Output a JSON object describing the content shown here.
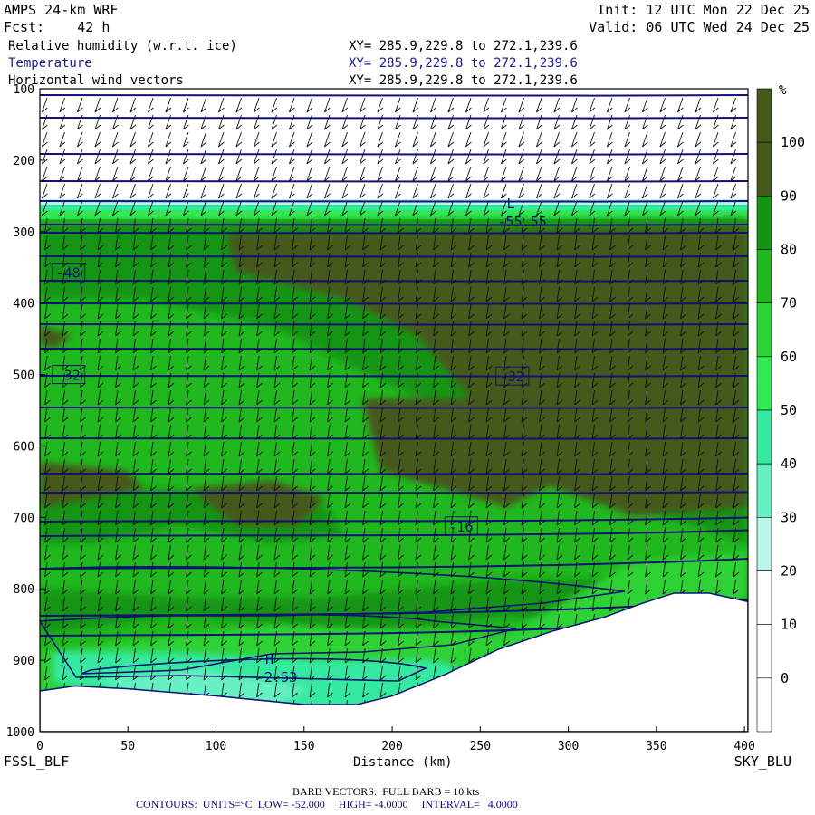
{
  "header": {
    "model": "AMPS 24-km WRF",
    "forecast": "Fcst:    42 h",
    "init": "Init: 12 UTC Mon 22 Dec 25",
    "valid": "Valid: 06 UTC Wed 24 Dec 25",
    "fields": [
      {
        "label": "Relative humidity (w.r.t. ice)",
        "xy": "XY= 285.9,229.8 to 272.1,239.6",
        "color": "#000000"
      },
      {
        "label": "Temperature",
        "xy": "XY= 285.9,229.8 to 272.1,239.6",
        "color": "#1b1b8f"
      },
      {
        "label": "Horizontal wind vectors",
        "xy": "XY= 285.9,229.8 to 272.1,239.6",
        "color": "#000000"
      }
    ]
  },
  "footer": {
    "left_station": "FSSL_BLF",
    "right_station": "SKY_BLU",
    "barb_note": "BARB VECTORS:  FULL BARB = 10 kts",
    "contour_note": "CONTOURS:  UNITS=°C  LOW= -52.000     HIGH= -4.0000     INTERVAL=   4.0000"
  },
  "chart_data": {
    "type": "heatmap",
    "xlabel": "Distance (km)",
    "ylabel": "Pressure (hPa)",
    "xlim": [
      0,
      402
    ],
    "ylim": [
      1000,
      100
    ],
    "x_ticks": [
      0,
      50,
      100,
      150,
      200,
      250,
      300,
      350,
      400
    ],
    "y_ticks": [
      100,
      200,
      300,
      400,
      500,
      600,
      700,
      800,
      900,
      1000
    ],
    "colorbar": {
      "unit": "%",
      "levels": [
        0,
        10,
        20,
        30,
        40,
        50,
        60,
        70,
        80,
        90,
        100
      ],
      "colors": [
        "#ffffff",
        "#ffffff",
        "#ffffff",
        "#b9f5e8",
        "#66f0c4",
        "#35eaa0",
        "#33e855",
        "#2fd236",
        "#20b81e",
        "#149414",
        "#46581a"
      ]
    },
    "terrain_pressure": [
      [
        0,
        943
      ],
      [
        20,
        936
      ],
      [
        50,
        940
      ],
      [
        100,
        950
      ],
      [
        150,
        962
      ],
      [
        180,
        962
      ],
      [
        200,
        950
      ],
      [
        230,
        920
      ],
      [
        260,
        885
      ],
      [
        290,
        860
      ],
      [
        320,
        840
      ],
      [
        340,
        822
      ],
      [
        360,
        806
      ],
      [
        380,
        806
      ],
      [
        402,
        818
      ]
    ],
    "temperature_contours": [
      {
        "label": "-48",
        "x": 7,
        "p": 357
      },
      {
        "label": "-32",
        "x": 7,
        "p": 500
      },
      {
        "label": "-32",
        "x": 259,
        "p": 502
      },
      {
        "label": "-16",
        "x": 230,
        "p": 712
      }
    ],
    "extrema": [
      {
        "type": "L",
        "symbol": "L",
        "value": "-55.55",
        "x": 265,
        "p": 290
      },
      {
        "type": "H",
        "symbol": "H",
        "value": "-2.53",
        "x": 128,
        "p": 928
      }
    ]
  }
}
